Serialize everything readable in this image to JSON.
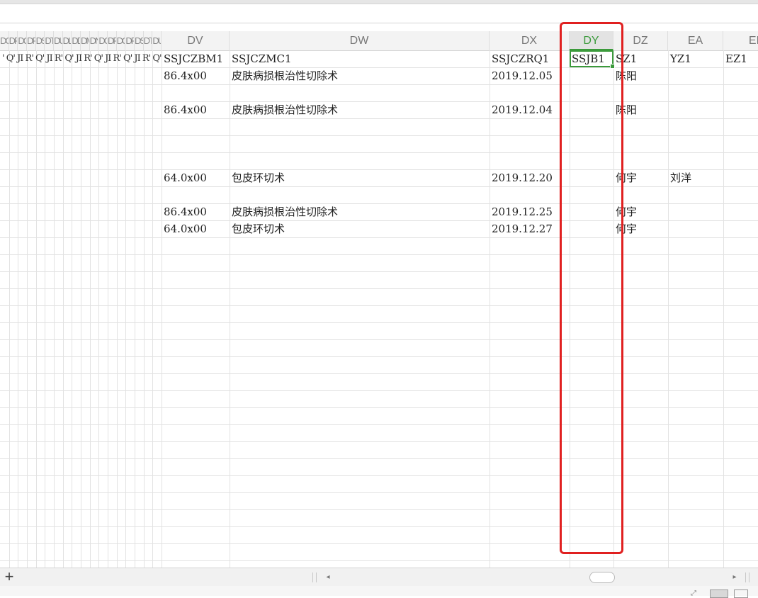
{
  "columns": {
    "narrow": [
      "DO",
      "DP",
      "DQ",
      "DR",
      "DS",
      "DT",
      "DU",
      "DL",
      "DD",
      "DM",
      "DN",
      "DO",
      "DP",
      "DQ",
      "DR",
      "DS",
      "DT",
      "DU"
    ],
    "dv": "DV",
    "dw": "DW",
    "dx": "DX",
    "dy": "DY",
    "dz": "DZ",
    "ea": "EA",
    "eb": "EI"
  },
  "row1_narrow_text": "' Q' JI R' Q' JI R' Q' JI R' Q' JI R' Q' JI R' Q' JI R'",
  "headers": {
    "dv": "SSJCZBM1",
    "dw": "SSJCZMC1",
    "dx": "SSJCZRQ1",
    "dy": "SSJB1",
    "dz": "SZ1",
    "ea": "YZ1",
    "eb": "EZ1"
  },
  "rows": [
    {
      "dv": "86.4x00",
      "dw": "皮肤病损根治性切除术",
      "dx": "2019.12.05",
      "dz": "陈阳",
      "ea": ""
    },
    {
      "dv": "",
      "dw": "",
      "dx": "",
      "dz": "",
      "ea": ""
    },
    {
      "dv": "86.4x00",
      "dw": "皮肤病损根治性切除术",
      "dx": "2019.12.04",
      "dz": "陈阳",
      "ea": ""
    },
    {
      "dv": "",
      "dw": "",
      "dx": "",
      "dz": "",
      "ea": ""
    },
    {
      "dv": "",
      "dw": "",
      "dx": "",
      "dz": "",
      "ea": ""
    },
    {
      "dv": "",
      "dw": "",
      "dx": "",
      "dz": "",
      "ea": ""
    },
    {
      "dv": "64.0x00",
      "dw": "包皮环切术",
      "dx": "2019.12.20",
      "dz": "何宇",
      "ea": "刘洋"
    },
    {
      "dv": "",
      "dw": "",
      "dx": "",
      "dz": "",
      "ea": ""
    },
    {
      "dv": "86.4x00",
      "dw": "皮肤病损根治性切除术",
      "dx": "2019.12.25",
      "dz": "何宇",
      "ea": ""
    },
    {
      "dv": "64.0x00",
      "dw": "包皮环切术",
      "dx": "2019.12.27",
      "dz": "何宇",
      "ea": ""
    }
  ],
  "bottom": {
    "add_sheet": "+",
    "scroll_left": "◂",
    "scroll_right": "▸"
  },
  "colors": {
    "selection": "#3b9a3b",
    "annotation": "#e02020",
    "gridline": "#e2e2e2"
  }
}
